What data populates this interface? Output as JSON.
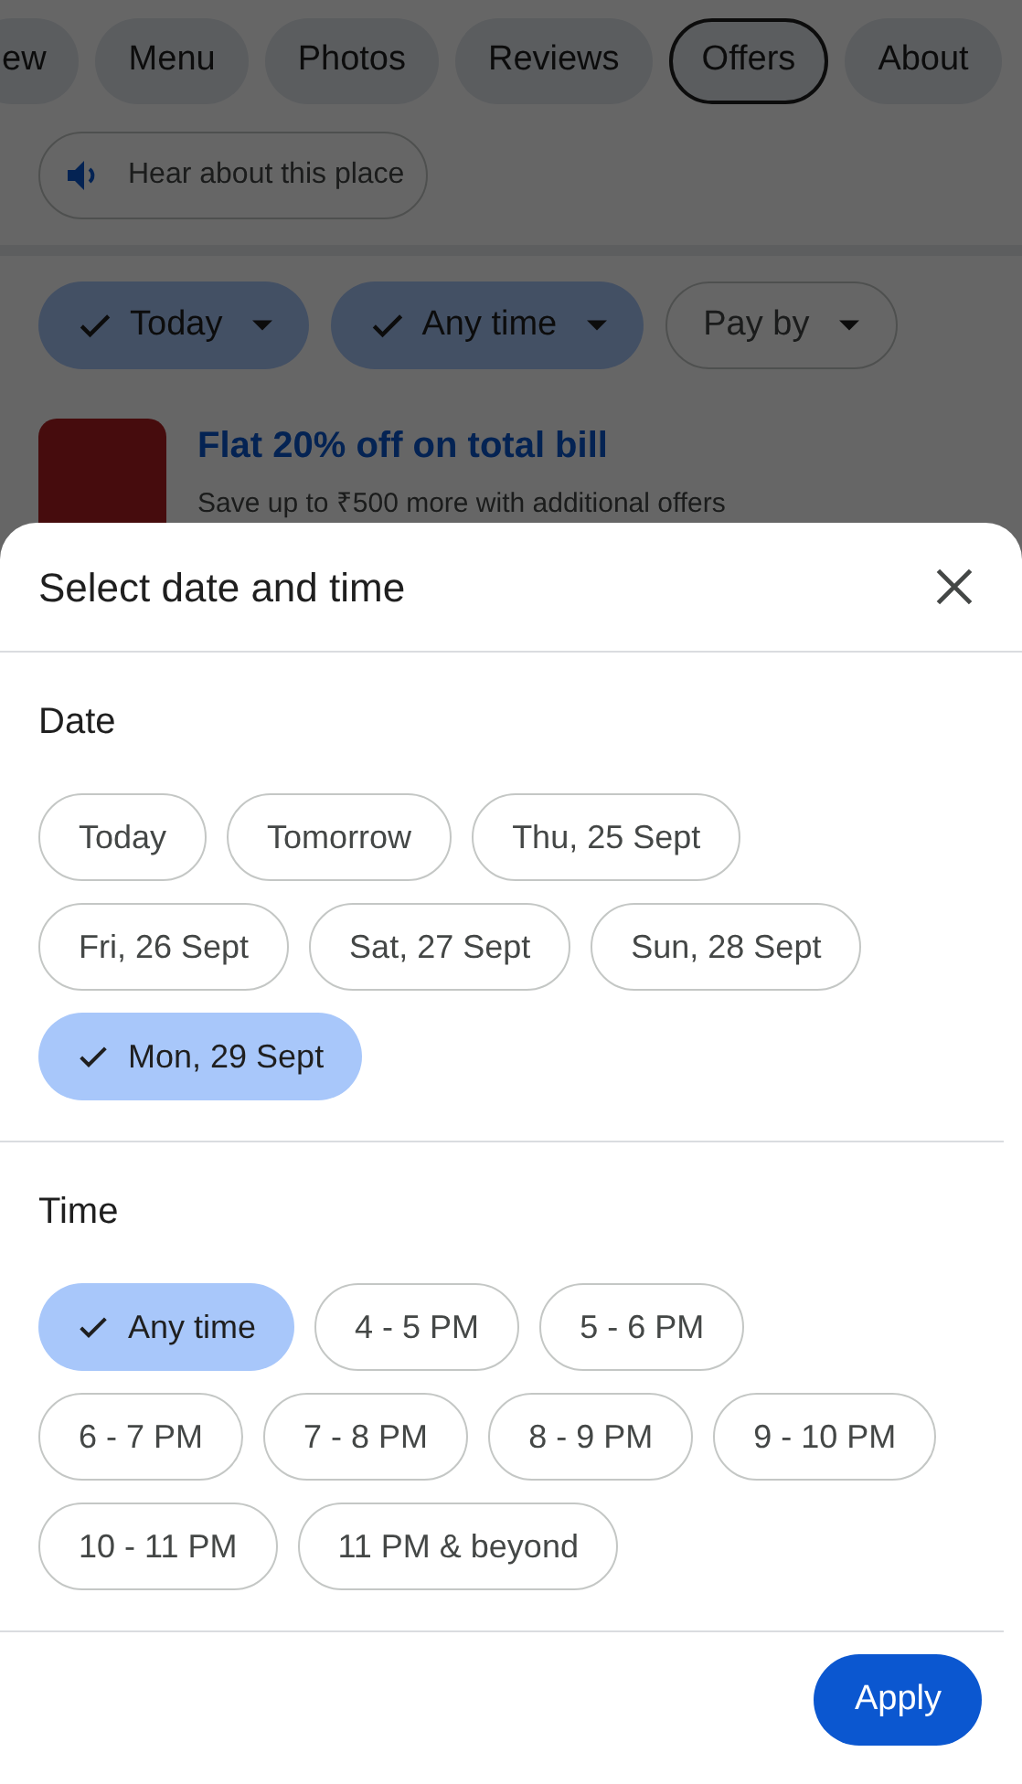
{
  "tabs": [
    {
      "label": "ew",
      "selected": false
    },
    {
      "label": "Menu",
      "selected": false
    },
    {
      "label": "Photos",
      "selected": false
    },
    {
      "label": "Reviews",
      "selected": false
    },
    {
      "label": "Offers",
      "selected": true
    },
    {
      "label": "About",
      "selected": false
    }
  ],
  "audio_button": {
    "label": "Hear about this place"
  },
  "filters": [
    {
      "label": "Today",
      "selected": true
    },
    {
      "label": "Any time",
      "selected": true
    },
    {
      "label": "Pay by",
      "selected": false
    }
  ],
  "offer": {
    "title": "Flat 20% off on total bill",
    "subtitle": "Save up to ₹500 more with additional offers"
  },
  "sheet": {
    "title": "Select date and time",
    "sections": [
      {
        "heading": "Date",
        "options": [
          {
            "label": "Today",
            "selected": false
          },
          {
            "label": "Tomorrow",
            "selected": false
          },
          {
            "label": "Thu, 25 Sept",
            "selected": false
          },
          {
            "label": "Fri, 26 Sept",
            "selected": false
          },
          {
            "label": "Sat, 27 Sept",
            "selected": false
          },
          {
            "label": "Sun, 28 Sept",
            "selected": false
          },
          {
            "label": "Mon, 29 Sept",
            "selected": true
          }
        ]
      },
      {
        "heading": "Time",
        "options": [
          {
            "label": "Any time",
            "selected": true
          },
          {
            "label": "4 - 5 PM",
            "selected": false
          },
          {
            "label": "5 - 6 PM",
            "selected": false
          },
          {
            "label": "6 - 7 PM",
            "selected": false
          },
          {
            "label": "7 - 8 PM",
            "selected": false
          },
          {
            "label": "8 - 9 PM",
            "selected": false
          },
          {
            "label": "9 - 10 PM",
            "selected": false
          },
          {
            "label": "10 - 11 PM",
            "selected": false
          },
          {
            "label": "11 PM & beyond",
            "selected": false
          }
        ]
      }
    ],
    "apply_button": "Apply"
  }
}
